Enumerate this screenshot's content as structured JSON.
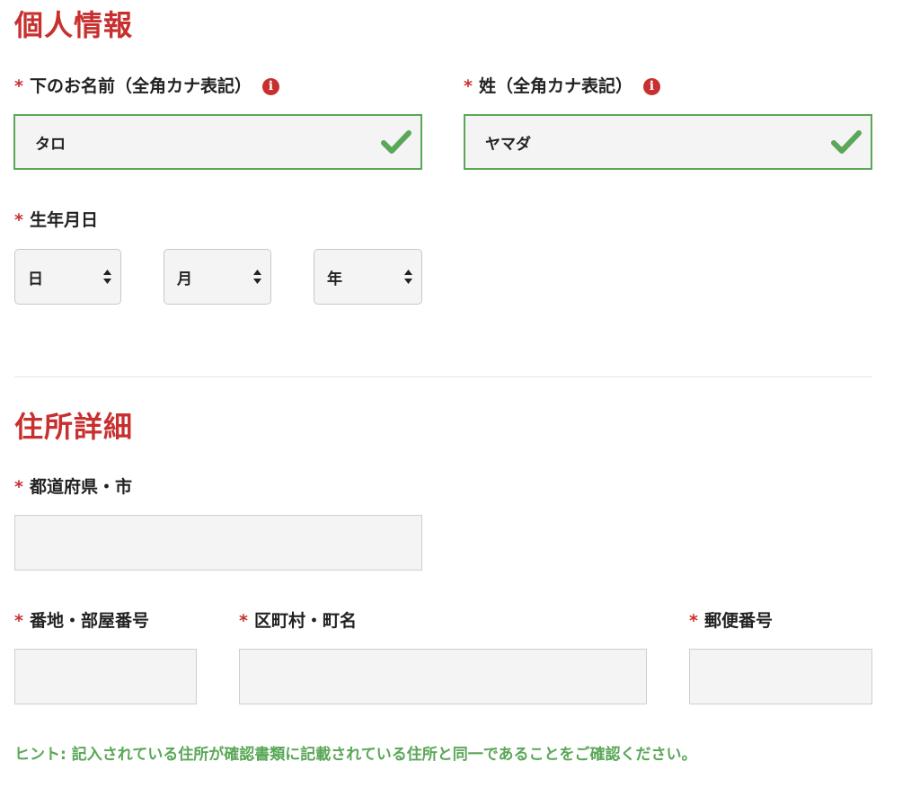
{
  "personal": {
    "title": "個人情報",
    "first_name": {
      "label": "下のお名前（全角カナ表記）",
      "value": "タロ",
      "required_mark": "*",
      "info_icon": "i"
    },
    "last_name": {
      "label": "姓（全角カナ表記）",
      "value": "ヤマダ",
      "required_mark": "*",
      "info_icon": "i"
    },
    "birthdate": {
      "label": "生年月日",
      "required_mark": "*",
      "day": "日",
      "month": "月",
      "year": "年"
    }
  },
  "address": {
    "title": "住所詳細",
    "prefecture_city": {
      "label": "都道府県・市",
      "required_mark": "*",
      "value": ""
    },
    "street_room": {
      "label": "番地・部屋番号",
      "required_mark": "*",
      "value": ""
    },
    "ward_town": {
      "label": "区町村・町名",
      "required_mark": "*",
      "value": ""
    },
    "postal_code": {
      "label": "郵便番号",
      "required_mark": "*",
      "value": ""
    },
    "hint": "ヒント: 記入されている住所が確認書類に記載されている住所と同一であることをご確認ください。"
  },
  "icons": {
    "valid": "checkmark-icon",
    "info": "info-icon",
    "select": "updown-arrows-icon"
  },
  "colors": {
    "accent_red": "#c8302f",
    "valid_green": "#5aa757",
    "input_bg": "#f4f4f4"
  }
}
